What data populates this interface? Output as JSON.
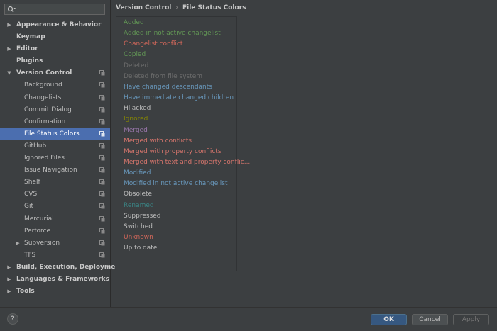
{
  "search": {
    "value": ""
  },
  "sidebar": {
    "items": [
      {
        "label": "Appearance & Behavior",
        "level": 0,
        "bold": true,
        "arrow": "right",
        "project": false,
        "selected": false
      },
      {
        "label": "Keymap",
        "level": 0,
        "bold": true,
        "arrow": "",
        "project": false,
        "selected": false
      },
      {
        "label": "Editor",
        "level": 0,
        "bold": true,
        "arrow": "right",
        "project": false,
        "selected": false
      },
      {
        "label": "Plugins",
        "level": 0,
        "bold": true,
        "arrow": "",
        "project": false,
        "selected": false
      },
      {
        "label": "Version Control",
        "level": 0,
        "bold": true,
        "arrow": "down",
        "project": true,
        "selected": false
      },
      {
        "label": "Background",
        "level": 1,
        "bold": false,
        "arrow": "",
        "project": true,
        "selected": false
      },
      {
        "label": "Changelists",
        "level": 1,
        "bold": false,
        "arrow": "",
        "project": true,
        "selected": false
      },
      {
        "label": "Commit Dialog",
        "level": 1,
        "bold": false,
        "arrow": "",
        "project": true,
        "selected": false
      },
      {
        "label": "Confirmation",
        "level": 1,
        "bold": false,
        "arrow": "",
        "project": true,
        "selected": false
      },
      {
        "label": "File Status Colors",
        "level": 1,
        "bold": false,
        "arrow": "",
        "project": true,
        "selected": true
      },
      {
        "label": "GitHub",
        "level": 1,
        "bold": false,
        "arrow": "",
        "project": true,
        "selected": false
      },
      {
        "label": "Ignored Files",
        "level": 1,
        "bold": false,
        "arrow": "",
        "project": true,
        "selected": false
      },
      {
        "label": "Issue Navigation",
        "level": 1,
        "bold": false,
        "arrow": "",
        "project": true,
        "selected": false
      },
      {
        "label": "Shelf",
        "level": 1,
        "bold": false,
        "arrow": "",
        "project": true,
        "selected": false
      },
      {
        "label": "CVS",
        "level": 1,
        "bold": false,
        "arrow": "",
        "project": true,
        "selected": false
      },
      {
        "label": "Git",
        "level": 1,
        "bold": false,
        "arrow": "",
        "project": true,
        "selected": false
      },
      {
        "label": "Mercurial",
        "level": 1,
        "bold": false,
        "arrow": "",
        "project": true,
        "selected": false
      },
      {
        "label": "Perforce",
        "level": 1,
        "bold": false,
        "arrow": "",
        "project": true,
        "selected": false
      },
      {
        "label": "Subversion",
        "level": 1,
        "bold": false,
        "arrow": "right",
        "project": true,
        "selected": false
      },
      {
        "label": "TFS",
        "level": 1,
        "bold": false,
        "arrow": "",
        "project": true,
        "selected": false
      },
      {
        "label": "Build, Execution, Deployment",
        "level": 0,
        "bold": true,
        "arrow": "right",
        "project": false,
        "selected": false
      },
      {
        "label": "Languages & Frameworks",
        "level": 0,
        "bold": true,
        "arrow": "right",
        "project": false,
        "selected": false
      },
      {
        "label": "Tools",
        "level": 0,
        "bold": true,
        "arrow": "right",
        "project": false,
        "selected": false
      }
    ]
  },
  "breadcrumb": {
    "parent": "Version Control",
    "separator": "›",
    "current": "File Status Colors"
  },
  "statuses": [
    {
      "label": "Added",
      "color": "#629755"
    },
    {
      "label": "Added in not active changelist",
      "color": "#629755"
    },
    {
      "label": "Changelist conflict",
      "color": "#d1675a"
    },
    {
      "label": "Copied",
      "color": "#629755"
    },
    {
      "label": "Deleted",
      "color": "#6c6c6c"
    },
    {
      "label": "Deleted from file system",
      "color": "#6c6c6c"
    },
    {
      "label": "Have changed descendants",
      "color": "#6897bb"
    },
    {
      "label": "Have immediate changed children",
      "color": "#6897bb"
    },
    {
      "label": "Hijacked",
      "color": "#bbbbbb"
    },
    {
      "label": "Ignored",
      "color": "#848504"
    },
    {
      "label": "Merged",
      "color": "#9876aa"
    },
    {
      "label": "Merged with conflicts",
      "color": "#d5756c"
    },
    {
      "label": "Merged with property conflicts",
      "color": "#d5756c"
    },
    {
      "label": "Merged with text and property conflic...",
      "color": "#d5756c"
    },
    {
      "label": "Modified",
      "color": "#6897bb"
    },
    {
      "label": "Modified in not active changelist",
      "color": "#6897bb"
    },
    {
      "label": "Obsolete",
      "color": "#bbbbbb"
    },
    {
      "label": "Renamed",
      "color": "#3a8484"
    },
    {
      "label": "Suppressed",
      "color": "#bbbbbb"
    },
    {
      "label": "Switched",
      "color": "#bbbbbb"
    },
    {
      "label": "Unknown",
      "color": "#d1675a"
    },
    {
      "label": "Up to date",
      "color": "#bbbbbb"
    }
  ],
  "footer": {
    "help_label": "?",
    "ok_label": "OK",
    "cancel_label": "Cancel",
    "apply_label": "Apply"
  }
}
